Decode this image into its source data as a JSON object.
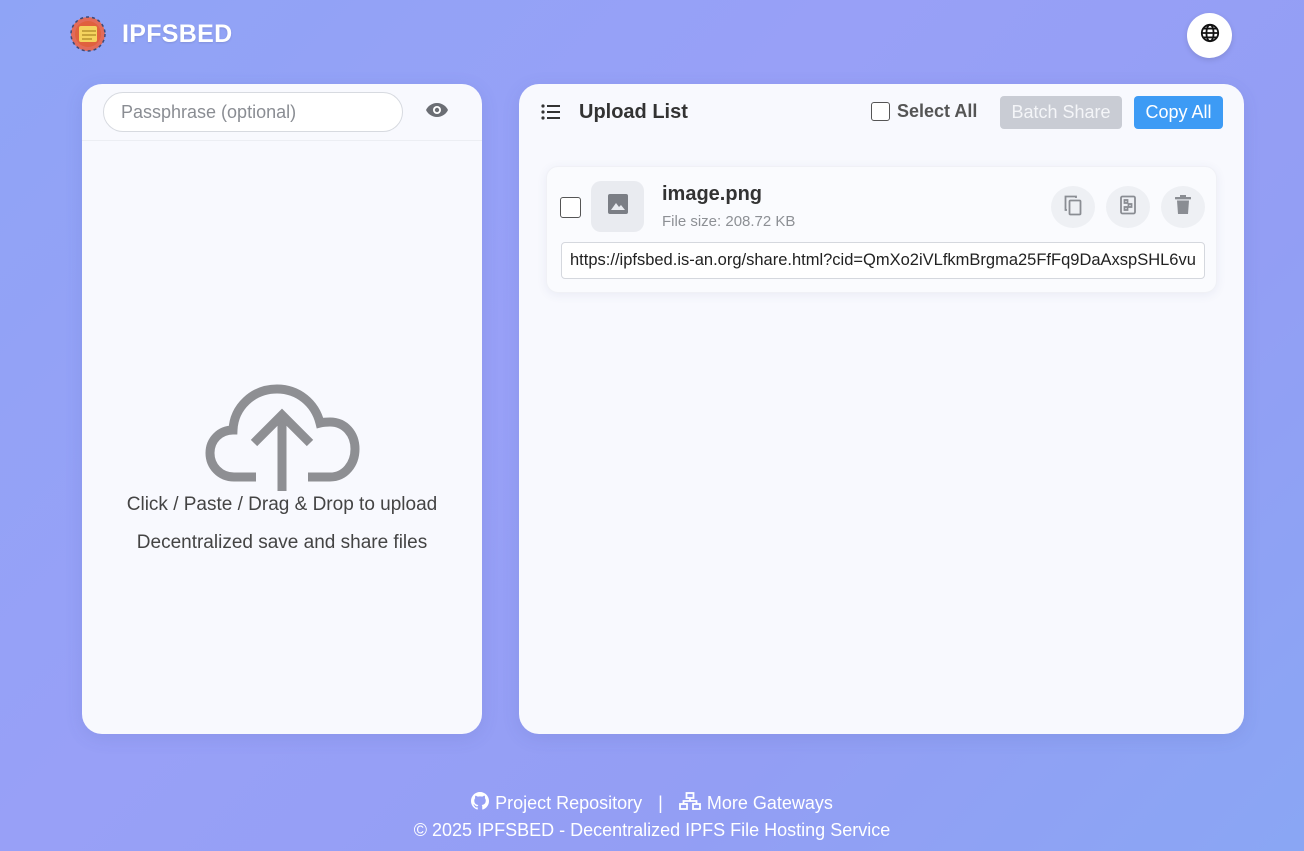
{
  "header": {
    "app_name": "IPFSBED",
    "logo_icon": "ipfs-cube-logo",
    "language_icon": "globe-icon"
  },
  "upload": {
    "passphrase_placeholder": "Passphrase (optional)",
    "eye_icon": "eye-icon",
    "cloud_icon": "cloud-upload-icon",
    "instruction": "Click / Paste / Drag & Drop to upload",
    "tagline": "Decentralized save and share files"
  },
  "list": {
    "title": "Upload List",
    "select_all_label": "Select All",
    "batch_share_label": "Batch Share",
    "copy_all_label": "Copy All",
    "items": [
      {
        "name": "image.png",
        "size": "File size: 208.72 KB",
        "url": "https://ipfsbed.is-an.org/share.html?cid=QmXo2iVLfkmBrgma25FfFq9DaAxspSHL6vu"
      }
    ]
  },
  "footer": {
    "repo_label": "Project Repository",
    "separator": "|",
    "gateways_label": "More Gateways",
    "copyright": "© 2025 IPFSBED - Decentralized IPFS File Hosting Service"
  },
  "colors": {
    "accent": "#3d9bf5",
    "disabled": "#c9ccd4",
    "panel": "#f8f9fe"
  }
}
